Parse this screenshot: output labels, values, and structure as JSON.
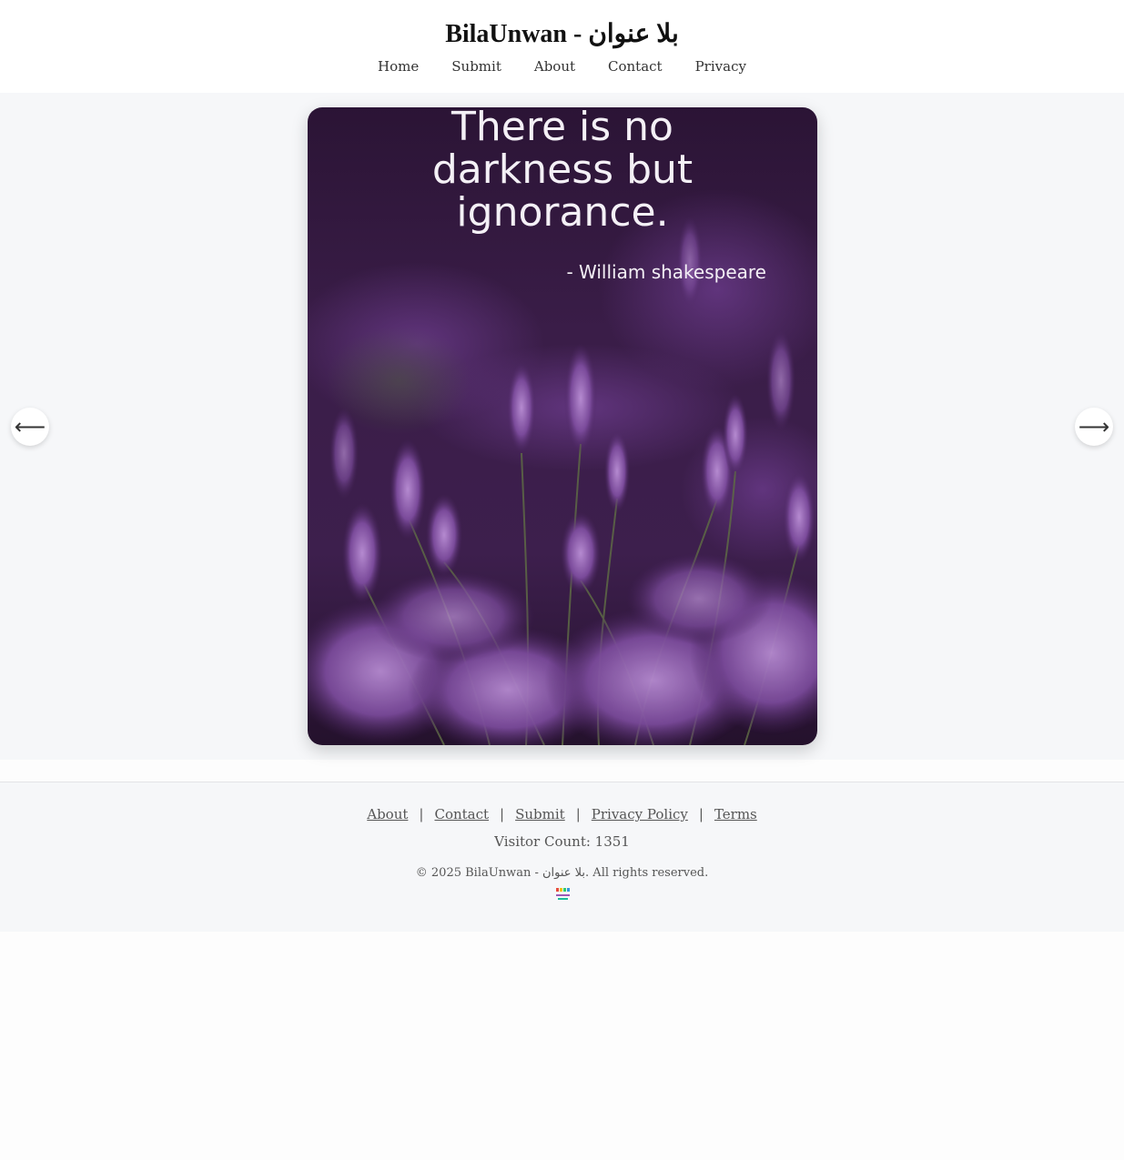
{
  "header": {
    "title": "BilaUnwan - بلا عنوان",
    "nav": [
      {
        "label": "Home"
      },
      {
        "label": "Submit"
      },
      {
        "label": "About"
      },
      {
        "label": "Contact"
      },
      {
        "label": "Privacy"
      }
    ]
  },
  "gallery": {
    "quote_lines": [
      "There is no",
      "darkness but",
      "ignorance."
    ],
    "quote_author": "- William shakespeare",
    "prev_icon": "arrow-left-icon",
    "next_icon": "arrow-right-icon",
    "prev_glyph": "⟵",
    "next_glyph": "⟶"
  },
  "footer": {
    "links": [
      {
        "label": "About"
      },
      {
        "label": "Contact"
      },
      {
        "label": "Submit"
      },
      {
        "label": "Privacy Policy"
      },
      {
        "label": "Terms"
      }
    ],
    "separator": "|",
    "visitor_count": "Visitor Count: 1351",
    "copyright": "© 2025 BilaUnwan - بلا عنوان. All rights reserved."
  },
  "colors": {
    "header_bg": "#ffffff",
    "gallery_bg": "#f6f7f9",
    "lavender_dark": "#2a1533",
    "lavender_mid": "#5b2f73",
    "lavender_light": "#9a6bb8"
  }
}
